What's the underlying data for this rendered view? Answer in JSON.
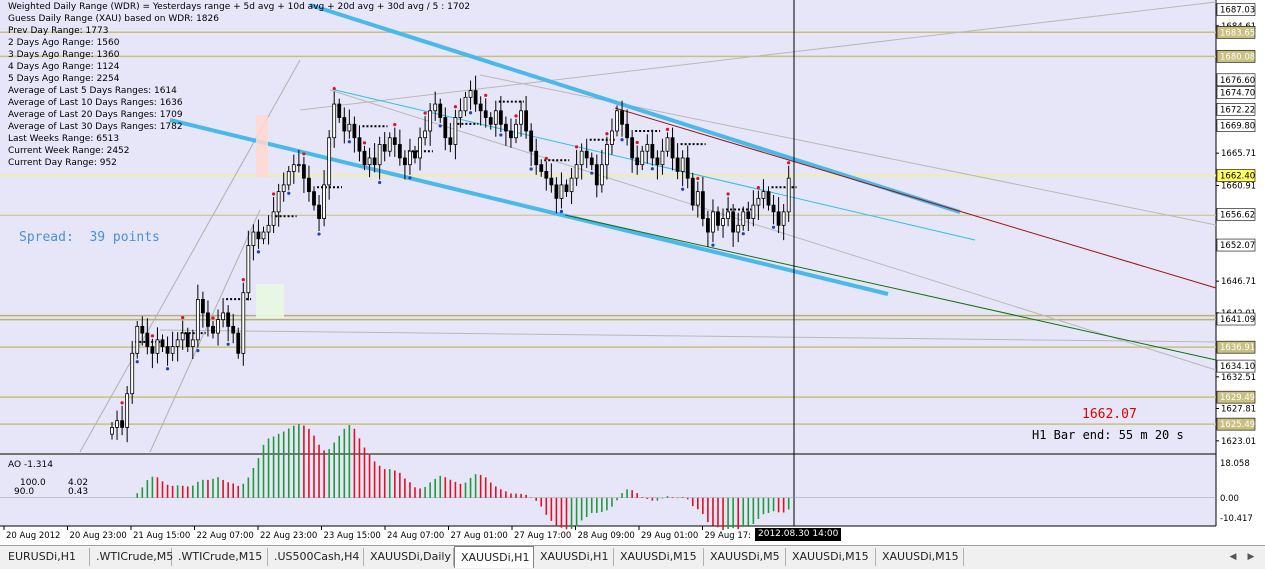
{
  "colors": {
    "background": "#e6e6f8",
    "up_candle": "#ffffff",
    "down_candle": "#000000",
    "channel_thick": "#4ab8e8",
    "channel_mid": "#2ec0e0",
    "level_line": "#c8c080",
    "current_price_line": "#f0f0a0",
    "crosshair": "#000000",
    "ao_up": "#1f9a3a",
    "ao_down": "#e01020",
    "red_text": "#e00000",
    "spread_text": "#4a90d8"
  },
  "info_panel": [
    "Weighted Daily Range (WDR) = Yesterdays range + 5d avg + 10d avg + 20d avg + 30d avg / 5 : 1702",
    "Guess Daily Range (XAU) based on WDR: 1826",
    "Prev Day Range: 1773",
    "2 Days Ago Range: 1560",
    "3 Days Ago Range: 1360",
    "4 Days Ago Range: 1124",
    "5 Days Ago Range: 2254",
    "Average of Last 5 Days Ranges: 1614",
    "Average of Last 10 Days Ranges: 1636",
    "Average of Last 20 Days Ranges: 1709",
    "Average of Last 30 Days Ranges: 1782",
    "Last Weeks Range: 6513",
    "Current Week Range: 2452",
    "Current Day Range: 952"
  ],
  "spread_label": "Spread:  39 points",
  "current_price": "1662.07",
  "bar_end_label": "H1 Bar end: 55 m 20 s",
  "ao_label": "AO -1.314",
  "ao_legend": [
    "100.0",
    "90.0",
    "4.02",
    "0.43"
  ],
  "price_axis_ticks": [
    "1684.61",
    "1665.71",
    "1660.91",
    "1646.71",
    "1642.01",
    "1632.51",
    "1627.81",
    "1623.01"
  ],
  "price_axis_boxes": [
    {
      "label": "1687.03",
      "value": 1687.03,
      "style": "white"
    },
    {
      "label": "1683.65",
      "value": 1683.65,
      "style": "level"
    },
    {
      "label": "1680.08",
      "value": 1680.08,
      "style": "level"
    },
    {
      "label": "1676.60",
      "value": 1676.6,
      "style": "white"
    },
    {
      "label": "1674.70",
      "value": 1674.7,
      "style": "white"
    },
    {
      "label": "1672.22",
      "value": 1672.22,
      "style": "white"
    },
    {
      "label": "1669.80",
      "value": 1669.8,
      "style": "white"
    },
    {
      "label": "1662.40",
      "value": 1662.4,
      "style": "yellow"
    },
    {
      "label": "1656.62",
      "value": 1656.62,
      "style": "white"
    },
    {
      "label": "1652.07",
      "value": 1652.07,
      "style": "white"
    },
    {
      "label": "1641.09",
      "value": 1641.09,
      "style": "white"
    },
    {
      "label": "1636.91",
      "value": 1636.91,
      "style": "level"
    },
    {
      "label": "1634.10",
      "value": 1634.1,
      "style": "white"
    },
    {
      "label": "1629.49",
      "value": 1629.49,
      "style": "level"
    },
    {
      "label": "1625.49",
      "value": 1625.49,
      "style": "level"
    }
  ],
  "ao_axis_ticks": [
    "18.058",
    "0.00",
    "-10.417"
  ],
  "time_axis": [
    "20 Aug 2012",
    "20 Aug 23:00",
    "21 Aug 15:00",
    "22 Aug 07:00",
    "22 Aug 23:00",
    "23 Aug 15:00",
    "24 Aug 07:00",
    "27 Aug 01:00",
    "27 Aug 17:00",
    "28 Aug 09:00",
    "29 Aug 01:00",
    "29 Aug 17:"
  ],
  "crosshair_time": "2012.08.30 14:00",
  "tabs": [
    "EURUSDi,H1",
    ".WTICrude,M5",
    ".WTICrude,M15",
    ".US500Cash,H4",
    "XAUUSDi,Daily",
    "XAUUSDi,H1",
    "XAUUSDi,H1",
    "XAUUSDi,M15",
    "XAUUSDi,M5",
    "XAUUSDi,M15",
    "XAUUSDi,M15"
  ],
  "active_tab": 5,
  "chart_data": {
    "type": "candlestick",
    "symbol": "XAUUSD",
    "timeframe": "H1",
    "ylim": [
      1621.5,
      1688.0
    ],
    "ao_ylim": [
      -12.5,
      19.5
    ],
    "close": [
      1625,
      1626,
      1625,
      1630,
      1636,
      1640,
      1639,
      1637,
      1636,
      1638,
      1637,
      1636,
      1637,
      1638,
      1639,
      1637,
      1638,
      1644,
      1642,
      1640,
      1639,
      1641,
      1642,
      1640,
      1639,
      1636,
      1645,
      1652,
      1654,
      1653,
      1654,
      1655,
      1657,
      1660,
      1661,
      1663,
      1664,
      1664,
      1662,
      1660,
      1658,
      1656,
      1661,
      1668,
      1673,
      1671,
      1669,
      1670,
      1668,
      1666,
      1664,
      1665,
      1664,
      1667,
      1666,
      1668,
      1667,
      1665,
      1664,
      1666,
      1665,
      1668,
      1669,
      1672,
      1673,
      1671,
      1668,
      1667,
      1671,
      1672,
      1674,
      1675,
      1673,
      1672,
      1671,
      1670,
      1672,
      1670,
      1669,
      1668,
      1670,
      1672,
      1669,
      1666,
      1664,
      1663,
      1662,
      1661,
      1659,
      1661,
      1660,
      1662,
      1664,
      1666,
      1665,
      1664,
      1661,
      1664,
      1667,
      1669,
      1672,
      1670,
      1668,
      1665,
      1664,
      1666,
      1667,
      1665,
      1664,
      1666,
      1668,
      1665,
      1663,
      1665,
      1662,
      1658,
      1660,
      1656,
      1654,
      1657,
      1655,
      1656,
      1657,
      1654,
      1655,
      1657,
      1656,
      1658,
      1659,
      1660,
      1658,
      1657,
      1655,
      1657,
      1662
    ]
  }
}
